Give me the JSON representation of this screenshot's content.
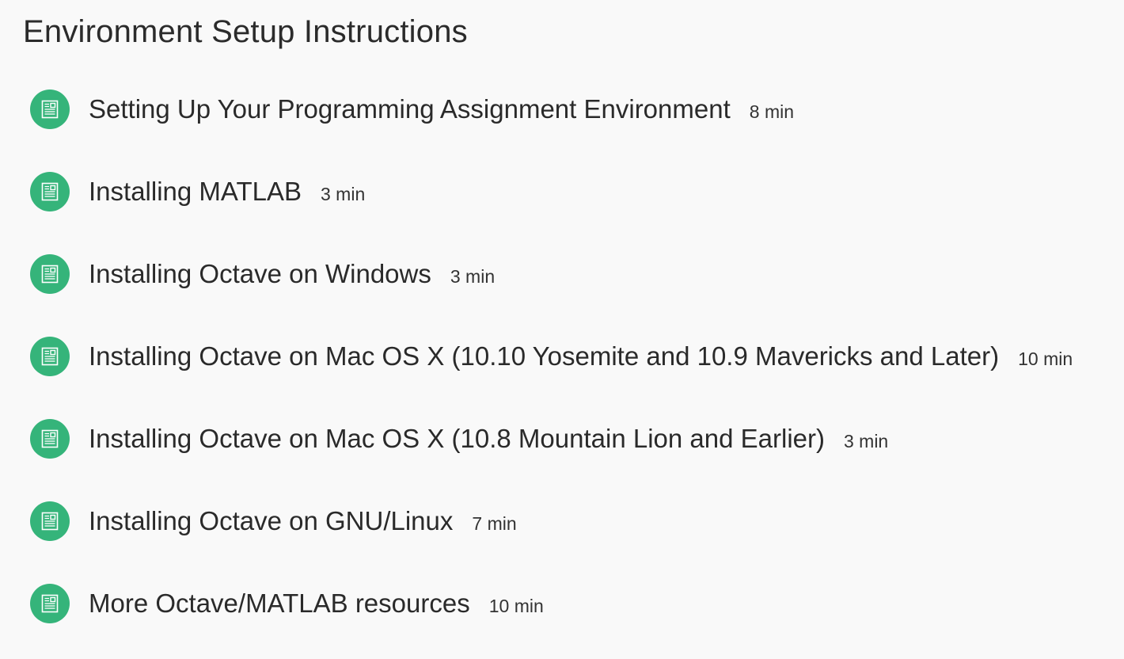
{
  "section": {
    "title": "Environment Setup Instructions"
  },
  "colors": {
    "icon_background": "#35b47a",
    "background": "#f9f9f9"
  },
  "items": [
    {
      "icon": "reading-document-icon",
      "title": "Setting Up Your Programming Assignment Environment",
      "duration": "8 min"
    },
    {
      "icon": "reading-document-icon",
      "title": "Installing MATLAB",
      "duration": "3 min"
    },
    {
      "icon": "reading-document-icon",
      "title": "Installing Octave on Windows",
      "duration": "3 min"
    },
    {
      "icon": "reading-document-icon",
      "title": "Installing Octave on Mac OS X (10.10 Yosemite and 10.9 Mavericks and Later)",
      "duration": "10 min"
    },
    {
      "icon": "reading-document-icon",
      "title": "Installing Octave on Mac OS X (10.8 Mountain Lion and Earlier)",
      "duration": "3 min"
    },
    {
      "icon": "reading-document-icon",
      "title": "Installing Octave on GNU/Linux",
      "duration": "7 min"
    },
    {
      "icon": "reading-document-icon",
      "title": "More Octave/MATLAB resources",
      "duration": "10 min"
    }
  ]
}
